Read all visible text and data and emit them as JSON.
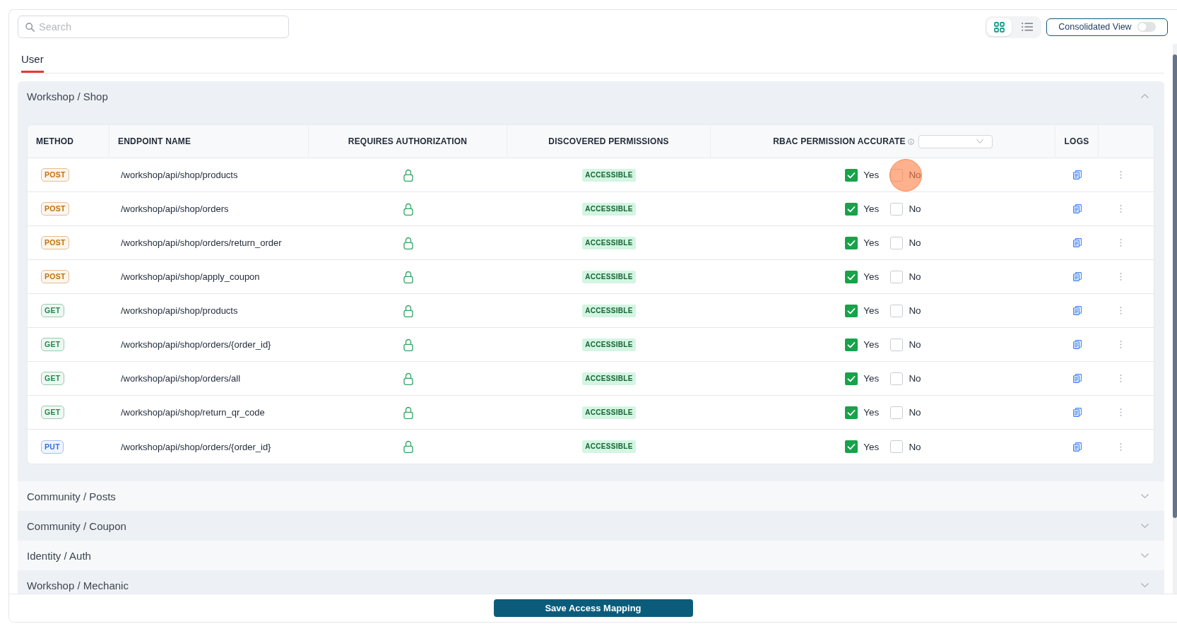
{
  "search": {
    "placeholder": "Search"
  },
  "view_modes": [
    {
      "kind": "grid",
      "selected": true
    },
    {
      "kind": "list",
      "selected": false
    }
  ],
  "consolidated_view": {
    "label": "Consolidated View",
    "on": false
  },
  "tabs": [
    {
      "label": "User",
      "selected": true
    }
  ],
  "sections": [
    {
      "title": "Workshop / Shop",
      "expanded": true,
      "columns": [
        "METHOD",
        "ENDPOINT NAME",
        "REQUIRES AUTHORIZATION",
        "DISCOVERED PERMISSIONS",
        "RBAC PERMISSION ACCURATE",
        "LOGS"
      ],
      "rows": [
        {
          "method": {
            "label": "POST",
            "color": "#c2710c"
          },
          "endpoint": "/workshop/api/shop/products",
          "permission": "ACCESSIBLE",
          "options": [
            {
              "label": "Yes",
              "checked": true,
              "click_marker": false
            },
            {
              "label": "No",
              "checked": false,
              "click_marker": true
            }
          ]
        },
        {
          "method": {
            "label": "POST",
            "color": "#c2710c"
          },
          "endpoint": "/workshop/api/shop/orders",
          "permission": "ACCESSIBLE",
          "options": [
            {
              "label": "Yes",
              "checked": true,
              "click_marker": false
            },
            {
              "label": "No",
              "checked": false,
              "click_marker": false
            }
          ]
        },
        {
          "method": {
            "label": "POST",
            "color": "#c2710c"
          },
          "endpoint": "/workshop/api/shop/orders/return_order",
          "permission": "ACCESSIBLE",
          "options": [
            {
              "label": "Yes",
              "checked": true,
              "click_marker": false
            },
            {
              "label": "No",
              "checked": false,
              "click_marker": false
            }
          ]
        },
        {
          "method": {
            "label": "POST",
            "color": "#c2710c"
          },
          "endpoint": "/workshop/api/shop/apply_coupon",
          "permission": "ACCESSIBLE",
          "options": [
            {
              "label": "Yes",
              "checked": true,
              "click_marker": false
            },
            {
              "label": "No",
              "checked": false,
              "click_marker": false
            }
          ]
        },
        {
          "method": {
            "label": "GET",
            "color": "#1f8a4c"
          },
          "endpoint": "/workshop/api/shop/products",
          "permission": "ACCESSIBLE",
          "options": [
            {
              "label": "Yes",
              "checked": true,
              "click_marker": false
            },
            {
              "label": "No",
              "checked": false,
              "click_marker": false
            }
          ]
        },
        {
          "method": {
            "label": "GET",
            "color": "#1f8a4c"
          },
          "endpoint": "/workshop/api/shop/orders/{order_id}",
          "permission": "ACCESSIBLE",
          "options": [
            {
              "label": "Yes",
              "checked": true,
              "click_marker": false
            },
            {
              "label": "No",
              "checked": false,
              "click_marker": false
            }
          ]
        },
        {
          "method": {
            "label": "GET",
            "color": "#1f8a4c"
          },
          "endpoint": "/workshop/api/shop/orders/all",
          "permission": "ACCESSIBLE",
          "options": [
            {
              "label": "Yes",
              "checked": true,
              "click_marker": false
            },
            {
              "label": "No",
              "checked": false,
              "click_marker": false
            }
          ]
        },
        {
          "method": {
            "label": "GET",
            "color": "#1f8a4c"
          },
          "endpoint": "/workshop/api/shop/return_qr_code",
          "permission": "ACCESSIBLE",
          "options": [
            {
              "label": "Yes",
              "checked": true,
              "click_marker": false
            },
            {
              "label": "No",
              "checked": false,
              "click_marker": false
            }
          ]
        },
        {
          "method": {
            "label": "PUT",
            "color": "#2f6fdb"
          },
          "endpoint": "/workshop/api/shop/orders/{order_id}",
          "permission": "ACCESSIBLE",
          "options": [
            {
              "label": "Yes",
              "checked": true,
              "click_marker": false
            },
            {
              "label": "No",
              "checked": false,
              "click_marker": false
            }
          ]
        }
      ]
    },
    {
      "title": "Community / Posts",
      "expanded": false
    },
    {
      "title": "Community / Coupon",
      "expanded": false
    },
    {
      "title": "Identity / Auth",
      "expanded": false
    },
    {
      "title": "Workshop / Mechanic",
      "expanded": false
    }
  ],
  "save_button": {
    "label": "Save Access Mapping"
  }
}
